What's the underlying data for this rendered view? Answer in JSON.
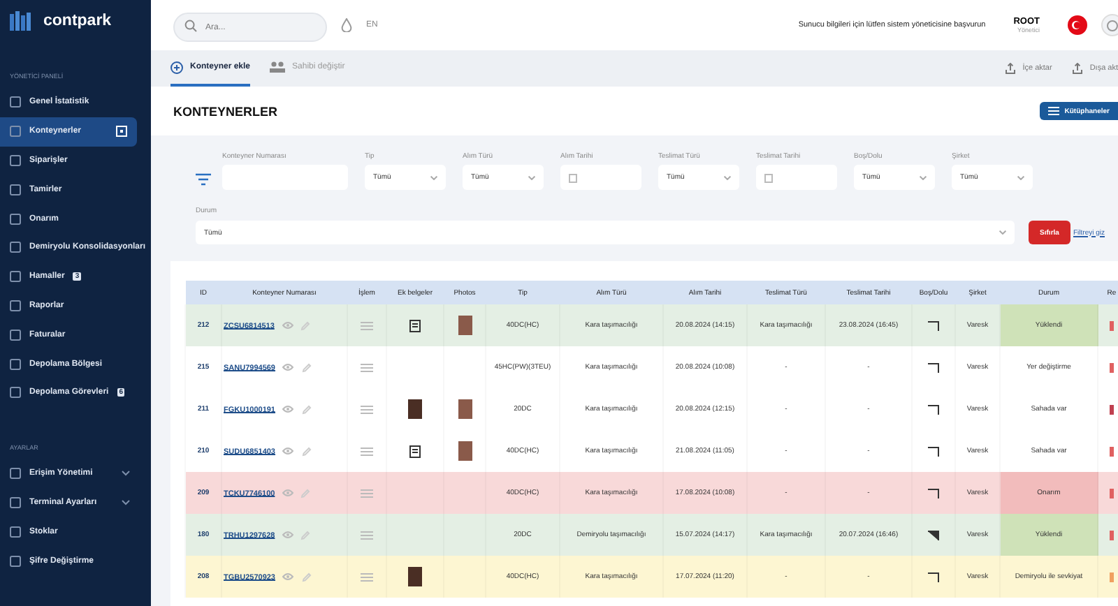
{
  "sidebar": {
    "logo": "contpark",
    "sections": [
      {
        "title": "YÖNETİCİ PANELİ",
        "items": [
          {
            "label": "Genel İstatistik",
            "selected": false,
            "expandable": false
          },
          {
            "label": "Konteynerler",
            "selected": true,
            "expandable": false
          },
          {
            "label": "Siparişler",
            "selected": false,
            "expandable": false
          },
          {
            "label": "Tamirler",
            "selected": false,
            "expandable": false
          },
          {
            "label": "Onarım",
            "selected": false,
            "expandable": false
          },
          {
            "label": "Demiryolu Konsolidasyonları",
            "selected": false,
            "expandable": false
          },
          {
            "label": "Hamaller",
            "selected": false,
            "expandable": false,
            "badge": "3"
          },
          {
            "label": "Raporlar",
            "selected": false,
            "expandable": false
          },
          {
            "label": "Faturalar",
            "selected": false,
            "expandable": false
          },
          {
            "label": "Depolama Bölgesi",
            "selected": false,
            "expandable": false
          },
          {
            "label": "Depolama Görevleri",
            "selected": false,
            "expandable": false,
            "badge": "6"
          }
        ]
      },
      {
        "title": "AYARLAR",
        "items": [
          {
            "label": "Erişim Yönetimi",
            "selected": false,
            "expandable": true
          },
          {
            "label": "Terminal Ayarları",
            "selected": false,
            "expandable": true
          },
          {
            "label": "Stoklar",
            "selected": false,
            "expandable": false
          },
          {
            "label": "Şifre Değiştirme",
            "selected": false,
            "expandable": false
          }
        ]
      }
    ]
  },
  "topbar": {
    "search": {
      "placeholder": "Ara..."
    },
    "language": "EN",
    "notice": "Sunucu bilgileri için lütfen sistem yöneticisine başvurun",
    "user": {
      "name": "ROOT",
      "role": "Yönetici"
    }
  },
  "tabs": [
    {
      "label": "Konteyner ekle",
      "selected": true
    },
    {
      "label": "Sahibi değiştir",
      "selected": false
    }
  ],
  "actions": [
    "İçe aktar",
    "Dışa akt"
  ],
  "title": "KONTEYNERLER",
  "columns_button": "Kütüphaneler",
  "filters": [
    {
      "label": "Konteyner Numarası",
      "kind": "text"
    },
    {
      "label": "Tip",
      "kind": "select",
      "value": "Tümü"
    },
    {
      "label": "Alım Türü",
      "kind": "select",
      "value": "Tümü"
    },
    {
      "label": "Alım Tarihi",
      "kind": "date"
    },
    {
      "label": "Teslimat Türü",
      "kind": "select",
      "value": "Tümü"
    },
    {
      "label": "Teslimat Tarihi",
      "kind": "date"
    },
    {
      "label": "Boş/Dolu",
      "kind": "select",
      "value": "Tümü"
    },
    {
      "label": "Şirket",
      "kind": "select",
      "value": "Tümü"
    }
  ],
  "status_filter": {
    "label": "Durum",
    "value": "Tümü"
  },
  "reset_button": "Sıfırla",
  "hide_filters_link": "Filtreyi giz",
  "table": {
    "columns": [
      "ID",
      "Konteyner Numarası",
      "İşlem",
      "Ek belgeler",
      "Photos",
      "Tip",
      "Alım Türü",
      "Alım Tarihi",
      "Teslimat Türü",
      "Teslimat Tarihi",
      "Boş/Dolu",
      "Şirket",
      "Durum",
      "Re"
    ],
    "rows": [
      {
        "id": "212",
        "container": "ZCSU6814513",
        "attachment": {
          "kind": "document"
        },
        "photo": true,
        "type": "40DC(HC)",
        "purchase_type": "Kara taşımacılığı",
        "purchase_date": "20.08.2024 (14:15)",
        "delivery_type": "Kara taşımacılığı",
        "delivery_date": "23.08.2024 (16:45)",
        "full": false,
        "company": "Varesk",
        "status": {
          "text": "Yüklendi",
          "color": "#cfe2b8"
        },
        "marker": {
          "color": "#e06060"
        },
        "color": "#e4efe4"
      },
      {
        "id": "215",
        "container": "SANU7994569",
        "photo": false,
        "type": "45HC(PW)(3TEU)",
        "purchase_type": "Kara taşımacılığı",
        "purchase_date": "20.08.2024 (10:08)",
        "delivery_type": "-",
        "delivery_date": "-",
        "full": false,
        "company": "Varesk",
        "status": {
          "text": "Yer değiştirme"
        },
        "marker": {
          "color": "#e06060"
        },
        "color": "#ffffff"
      },
      {
        "id": "211",
        "container": "FGKU1000191",
        "attachment": {
          "kind": "photo"
        },
        "photo": true,
        "type": "20DC",
        "purchase_type": "Kara taşımacılığı",
        "purchase_date": "20.08.2024 (12:15)",
        "delivery_type": "-",
        "delivery_date": "-",
        "full": false,
        "company": "Varesk",
        "status": {
          "text": "Sahada var"
        },
        "marker": {
          "color": "#c04050"
        },
        "color": "#ffffff"
      },
      {
        "id": "210",
        "container": "SUDU6851403",
        "attachment": {
          "kind": "document"
        },
        "photo": true,
        "type": "40DC(HC)",
        "purchase_type": "Kara taşımacılığı",
        "purchase_date": "21.08.2024 (11:05)",
        "delivery_type": "-",
        "delivery_date": "-",
        "full": false,
        "company": "Varesk",
        "status": {
          "text": "Sahada var"
        },
        "marker": {
          "color": "#e06060"
        },
        "color": "#ffffff"
      },
      {
        "id": "209",
        "container": "TCKU7746100",
        "photo": false,
        "type": "40DC(HC)",
        "purchase_type": "Kara taşımacılığı",
        "purchase_date": "17.08.2024 (10:08)",
        "delivery_type": "-",
        "delivery_date": "-",
        "full": false,
        "company": "Varesk",
        "status": {
          "text": "Onarım",
          "color": "#f2bcbc"
        },
        "marker": {
          "color": "#e06060"
        },
        "color": "#f8d9d9"
      },
      {
        "id": "180",
        "container": "TRHU1297628",
        "photo": false,
        "type": "20DC",
        "purchase_type": "Demiryolu taşımacılığı",
        "purchase_date": "15.07.2024 (14:17)",
        "delivery_type": "Kara taşımacılığı",
        "delivery_date": "20.07.2024 (16:46)",
        "full": true,
        "company": "Varesk",
        "status": {
          "text": "Yüklendi",
          "color": "#cfe2b8"
        },
        "marker": {
          "color": "#e06060"
        },
        "color": "#e4efe4"
      },
      {
        "id": "208",
        "container": "TGBU2570923",
        "attachment": {
          "kind": "photo"
        },
        "photo": false,
        "type": "40DC(HC)",
        "purchase_type": "Kara taşımacılığı",
        "purchase_date": "17.07.2024 (11:20)",
        "delivery_type": "-",
        "delivery_date": "-",
        "full": false,
        "company": "Varesk",
        "status": {
          "text": "Demiryolu ile sevkiyat"
        },
        "marker": {
          "color": "#f0a060"
        },
        "color": "#fdf6d2"
      }
    ]
  }
}
